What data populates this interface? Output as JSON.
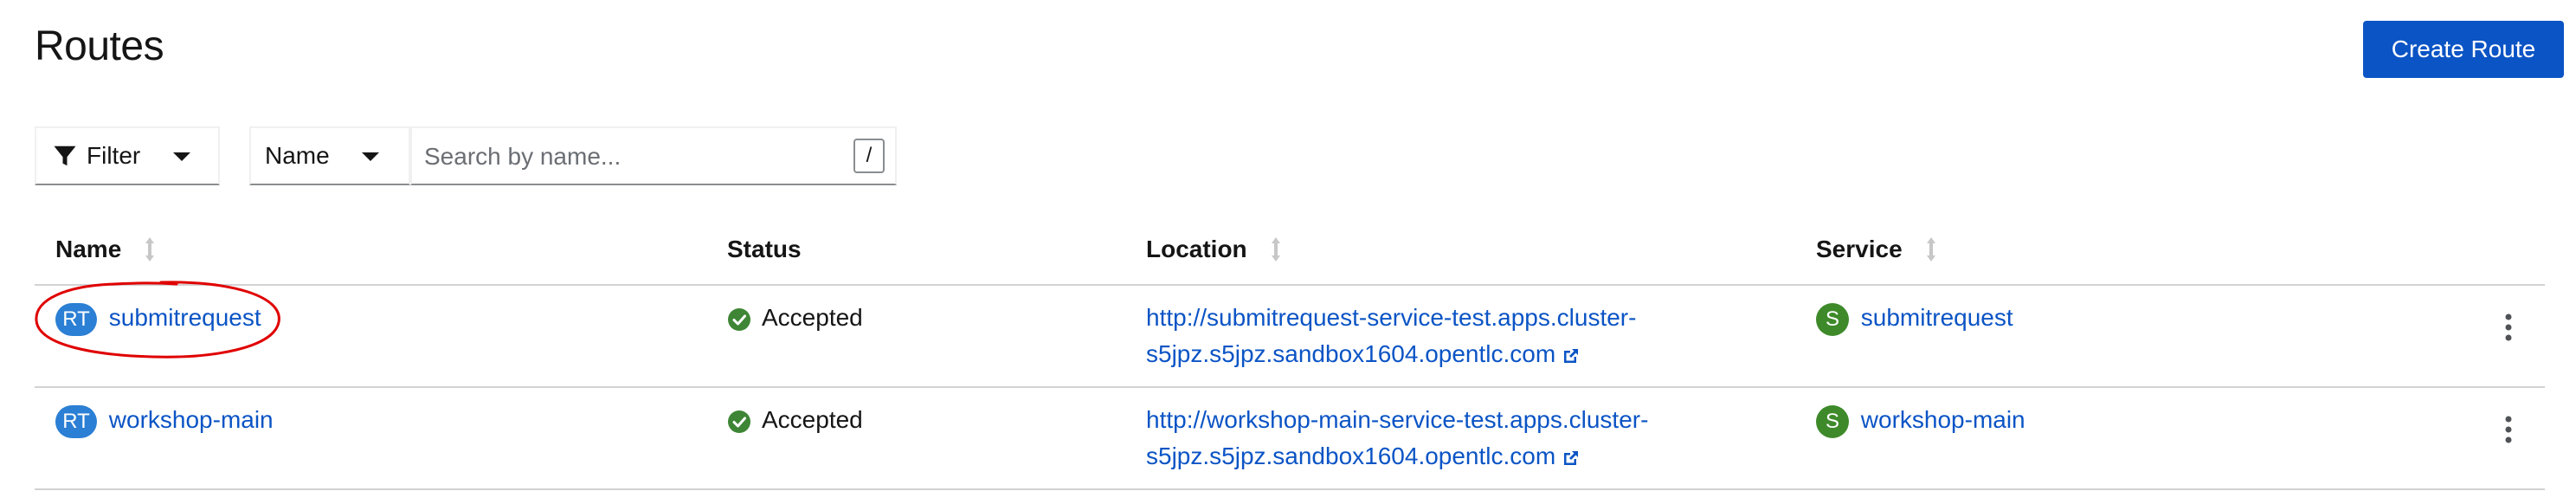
{
  "header": {
    "title": "Routes",
    "create_button_label": "Create Route"
  },
  "toolbar": {
    "filter_label": "Filter",
    "name_dropdown_label": "Name",
    "search_placeholder": "Search by name...",
    "search_value": "",
    "shortcut_key": "/"
  },
  "table": {
    "columns": [
      {
        "label": "Name",
        "sortable": true
      },
      {
        "label": "Status",
        "sortable": false
      },
      {
        "label": "Location",
        "sortable": true
      },
      {
        "label": "Service",
        "sortable": true
      }
    ],
    "rows": [
      {
        "badge": "RT",
        "name": "submitrequest",
        "status": "Accepted",
        "location_line1": "http://submitrequest-service-test.apps.cluster-",
        "location_line2": "s5jpz.s5jpz.sandbox1604.opentlc.com",
        "service_badge": "S",
        "service": "submitrequest"
      },
      {
        "badge": "RT",
        "name": "workshop-main",
        "status": "Accepted",
        "location_line1": "http://workshop-main-service-test.apps.cluster-",
        "location_line2": "s5jpz.s5jpz.sandbox1604.opentlc.com",
        "service_badge": "S",
        "service": "workshop-main"
      }
    ]
  },
  "colors": {
    "primary": "#0b54c5",
    "route_badge": "#2b7fd4",
    "service_badge": "#3e8a2a",
    "status_success": "#3e8635",
    "annotation": "#e00000"
  },
  "icons": {
    "filter": "filter-icon",
    "caret": "caret-down-icon",
    "sort": "sort-icon",
    "status": "check-circle-icon",
    "external": "external-link-icon",
    "kebab": "kebab-menu-icon"
  }
}
